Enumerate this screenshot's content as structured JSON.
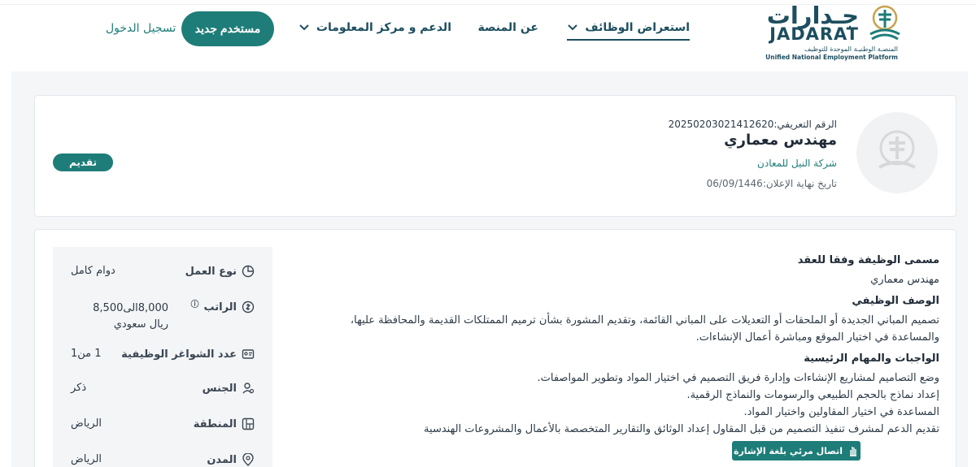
{
  "header": {
    "logo_ar": "جـدارات",
    "logo_en": "JADARAT",
    "logo_sub_ar": "المنصـة الوطنيـة الموحدة للتوظيف",
    "logo_sub_en": "Unified National Employment Platform",
    "nav": {
      "jobs": "استعراض الوظائف",
      "about": "عن المنصة",
      "support": "الدعم و مركز المعلومات"
    },
    "new_user_label": "مستخدم جديد",
    "login_label": "تسجيل الدخول"
  },
  "job": {
    "id_line": "الرقم التعريفي:20250203021412620",
    "title": "مهندس معماري",
    "company": "شركة النيل  للمعادن",
    "deadline_line": "تاريخ نهاية الإعلان:06/09/1446",
    "apply_label": "تقديم"
  },
  "details": {
    "work_type_label": "نوع العمل",
    "work_type_value": "دوام كامل",
    "salary_label": "الراتب",
    "salary_value": "8,000الى8,500 ريال سعودي",
    "vacancies_label": "عدد الشواغر الوظيفية",
    "vacancies_value": "1 من1",
    "gender_label": "الجنس",
    "gender_value": "ذكر",
    "region_label": "المنطقة",
    "region_value": "الرياض",
    "city_label": "المدن",
    "city_value": "الرياض"
  },
  "description": {
    "contract_title_h": "مسمى الوظيفة وفقا للعقد",
    "contract_title": "مهندس معماري",
    "desc_h": "الوصف الوظيفي",
    "desc_1": "تصميم المباني الجديدة أو الملحقات أو التعديلات على المباني القائمة، وتقديم المشورة بشأن ترميم الممتلكات القديمة والمحافظة عليها،",
    "desc_2": "والمساعدة في اختيار الموقع ومباشرة أعمال الإنشاءات.",
    "duties_h": "الواجبات والمهام الرئيسية",
    "duty_1": "وضع التصاميم لمشاريع الإنشاءات وإدارة فريق التصميم في اختيار المواد وتطوير المواصفات.",
    "duty_2": "إعداد نماذج بالحجم الطبيعي والرسومات والنماذج الرقمية.",
    "duty_3": "المساعدة في اختيار المقاولين واختيار المواد.",
    "duty_4": "تقديم الدعم لمشرف تنفيذ التصميم من قبل المقاول إعداد الوثائق والتقارير المتخصصة بالأعمال والمشروعات الهندسية"
  },
  "accessibility": {
    "sign_language_label": "اتصال مرئي بلغة الإشارة"
  }
}
